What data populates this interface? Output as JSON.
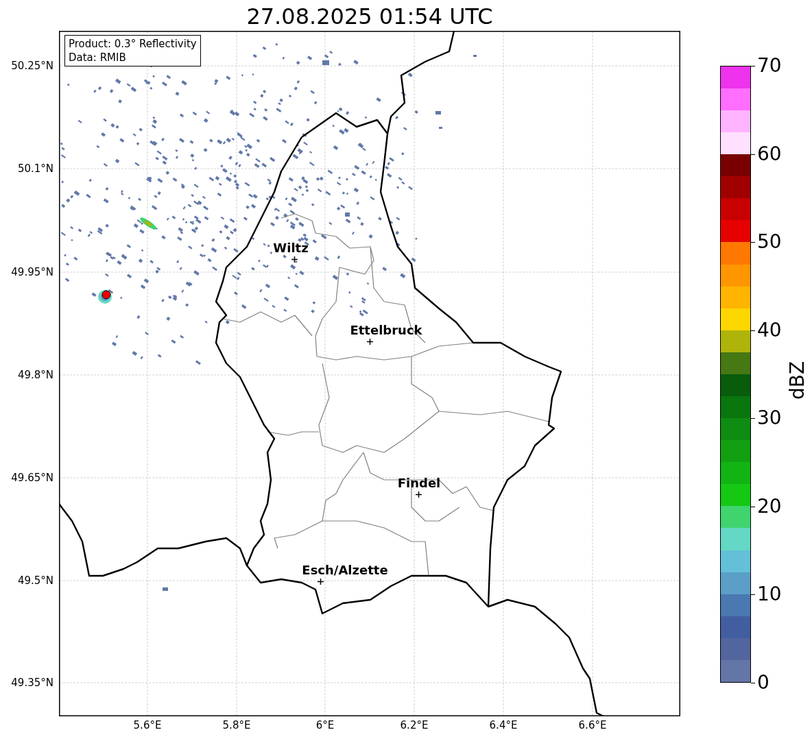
{
  "title": "27.08.2025 01:54 UTC",
  "info_box": {
    "lines": [
      "Product: 0.3° Reflectivity",
      "Data: RMIB"
    ]
  },
  "map": {
    "y_ticks": [
      "50.25°N",
      "50.1°N",
      "49.95°N",
      "49.8°N",
      "49.65°N",
      "49.5°N",
      "49.35°N"
    ],
    "x_ticks": [
      "5.6°E",
      "5.8°E",
      "6°E",
      "6.2°E",
      "6.4°E",
      "6.6°E"
    ],
    "cities": [
      {
        "name": "Wiltz"
      },
      {
        "name": "Ettelbruck"
      },
      {
        "name": "Findel"
      },
      {
        "name": "Esch/Alzette"
      }
    ]
  },
  "colorbar": {
    "label": "dBZ",
    "ticks": [
      "70",
      "60",
      "50",
      "40",
      "30",
      "20",
      "10",
      "0"
    ],
    "segments": [
      {
        "color": "#6475a8"
      },
      {
        "color": "#53659e"
      },
      {
        "color": "#435ea0"
      },
      {
        "color": "#4a78b0"
      },
      {
        "color": "#5b9ec8"
      },
      {
        "color": "#64c0d8"
      },
      {
        "color": "#64d8c4"
      },
      {
        "color": "#3fd46e"
      },
      {
        "color": "#14c814"
      },
      {
        "color": "#12b414"
      },
      {
        "color": "#12a012"
      },
      {
        "color": "#0f8c12"
      },
      {
        "color": "#0a760e"
      },
      {
        "color": "#085c0c"
      },
      {
        "color": "#467814"
      },
      {
        "color": "#afb40a"
      },
      {
        "color": "#ffd700"
      },
      {
        "color": "#ffb400"
      },
      {
        "color": "#ff9600"
      },
      {
        "color": "#ff7800"
      },
      {
        "color": "#e60000"
      },
      {
        "color": "#c80000"
      },
      {
        "color": "#a00000"
      },
      {
        "color": "#780000"
      },
      {
        "color": "#ffe0ff"
      },
      {
        "color": "#ffb4ff"
      },
      {
        "color": "#ff6eff"
      },
      {
        "color": "#ee33ee"
      }
    ]
  }
}
